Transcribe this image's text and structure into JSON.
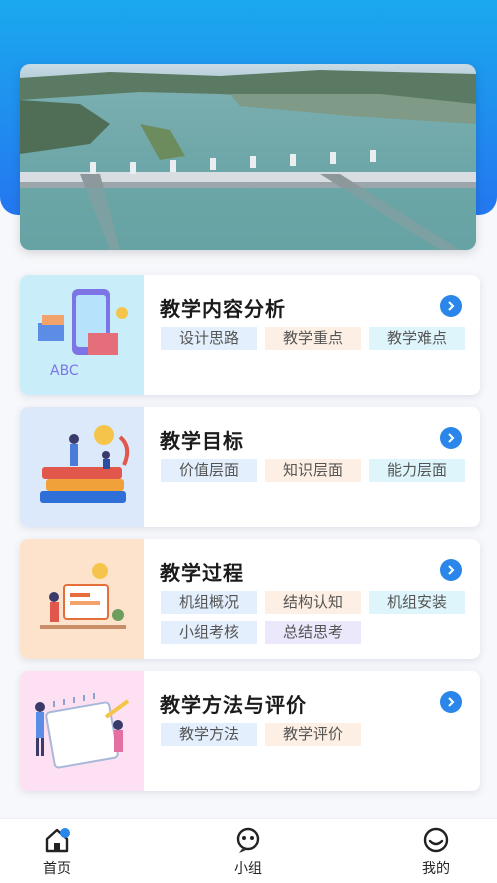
{
  "banner": {
    "alt_icon": "dam-aerial-photo"
  },
  "cards": [
    {
      "title": "教学内容分析",
      "tags": [
        "设计思路",
        "教学重点",
        "教学难点"
      ],
      "thumb_color": "#c9eefa"
    },
    {
      "title": "教学目标",
      "tags": [
        "价值层面",
        "知识层面",
        "能力层面"
      ],
      "thumb_color": "#dbe9fb"
    },
    {
      "title": "教学过程",
      "tags": [
        "机组概况",
        "结构认知",
        "机组安装",
        "小组考核",
        "总结思考"
      ],
      "thumb_color": "#fde3cc"
    },
    {
      "title": "教学方法与评价",
      "tags": [
        "教学方法",
        "教学评价"
      ],
      "thumb_color": "#fde1f2"
    }
  ],
  "nav": [
    {
      "label": "首页",
      "icon": "home-icon"
    },
    {
      "label": "小组",
      "icon": "group-icon"
    },
    {
      "label": "我的",
      "icon": "profile-icon"
    }
  ],
  "colors": {
    "accent": "#2a86e8",
    "header_top": "#1aa9ee",
    "header_bottom": "#2477f0"
  }
}
